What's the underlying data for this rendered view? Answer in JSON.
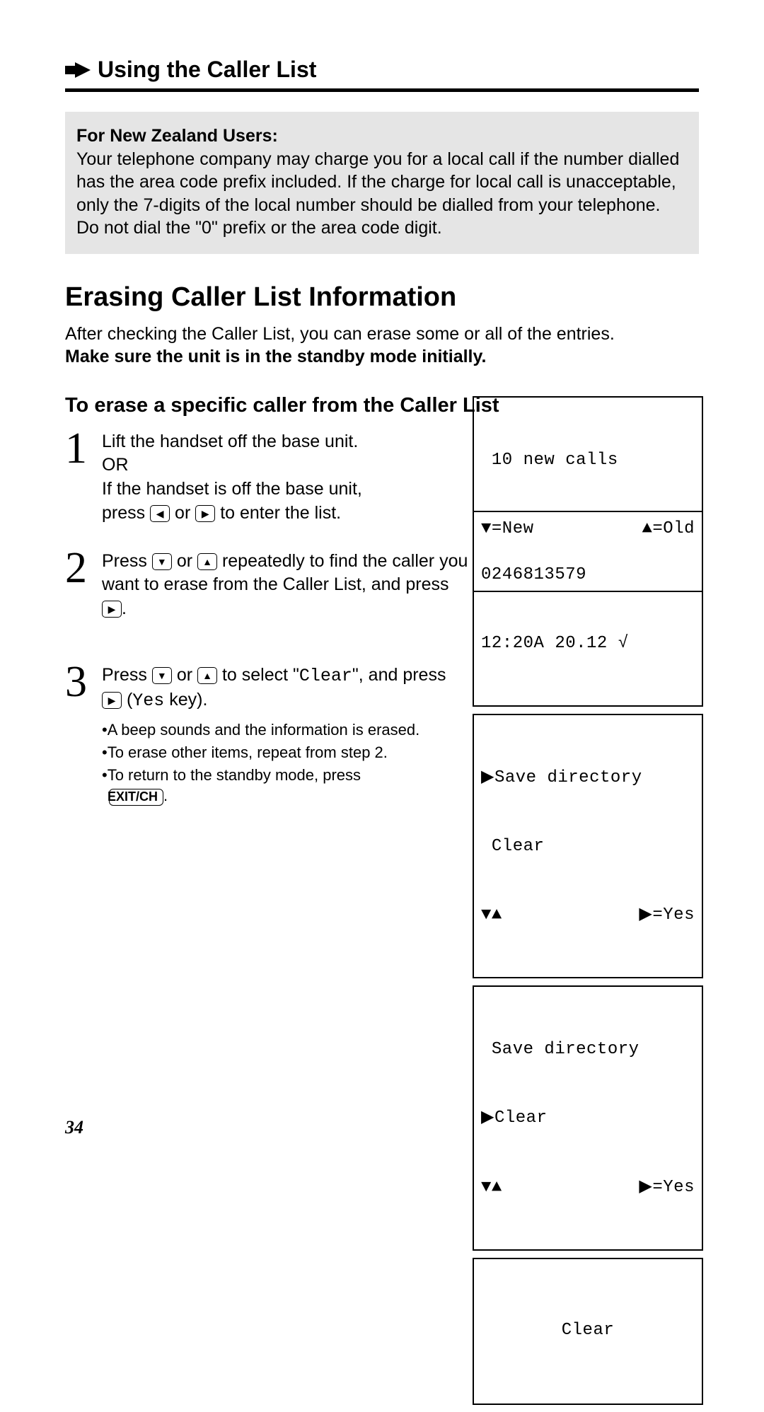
{
  "header": {
    "title": "Using the Caller List"
  },
  "note": {
    "title": "For New Zealand Users:",
    "body": "Your telephone company may charge you for a local call if the number dialled has the area code prefix included. If the charge for local call is unacceptable, only the 7-digits of the local number should be dialled from your telephone. Do not dial the \"0\" prefix or the area code digit."
  },
  "section_title": "Erasing Caller List Information",
  "intro_line1": "After checking the Caller List, you can erase some or all of the entries.",
  "intro_line2": "Make sure the unit is in the standby mode initially.",
  "sub_title": "To erase a specific caller from the Caller List",
  "steps": {
    "s1": {
      "num": "1",
      "l1": "Lift the handset off the base unit.",
      "l2": "OR",
      "l3a": "If the handset is off the base unit,",
      "l3b": "press ",
      "l3c": " or ",
      "l3d": " to enter the list."
    },
    "s2": {
      "num": "2",
      "a": "Press ",
      "b": " or ",
      "c": " repeatedly to find the caller you want to erase from the Caller List, and press ",
      "d": "."
    },
    "s3": {
      "num": "3",
      "a": "Press ",
      "b": " or ",
      "c": " to select \"",
      "clear": "Clear",
      "d": "\", and press ",
      "e": " (",
      "yes": "Yes",
      "f": " key).",
      "bul1": "•A beep sounds and the information is erased.",
      "bul2": "•To erase other items, repeat from step 2.",
      "bul3a": "•To return to the standby mode, press",
      "exit": "EXIT/CH",
      "bul3b": "."
    }
  },
  "lcd1": {
    "row1": " 10 new calls",
    "left": "▼=New",
    "right": "▲=Old"
  },
  "lcd2": {
    "row1": "0246813579",
    "row2": "12:20A 20.12 √"
  },
  "lcd3": {
    "row1": "▶Save directory",
    "row2": " Clear",
    "left": "▼▲",
    "right": "▶=Yes"
  },
  "lcd4": {
    "row1": " Save directory",
    "row2": "▶Clear",
    "left": "▼▲",
    "right": "▶=Yes"
  },
  "lcd5": {
    "row1": "Clear"
  },
  "page_number": "34"
}
